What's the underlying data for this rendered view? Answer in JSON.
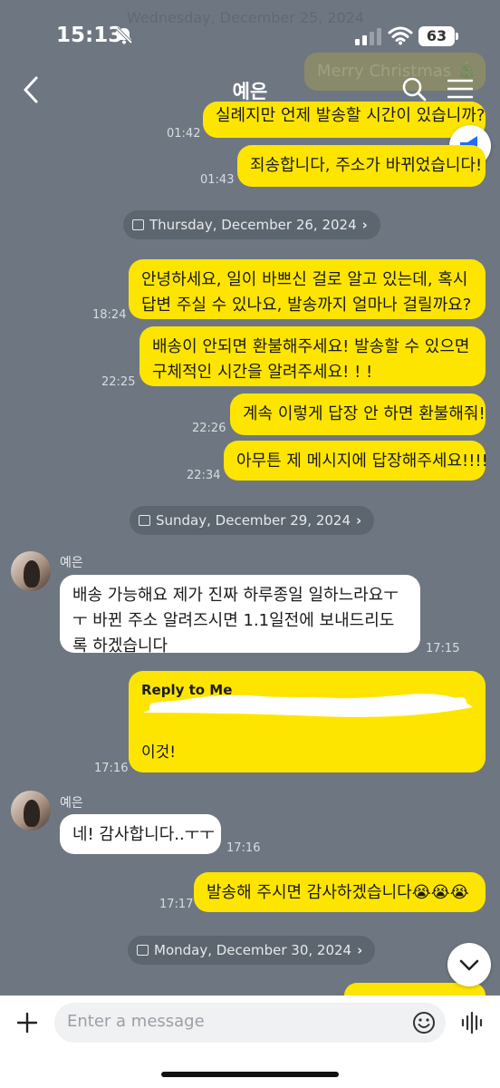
{
  "status_bar": {
    "time": "15:13",
    "battery": "63"
  },
  "ghost": {
    "date": "Wednesday, December 25, 2024",
    "bubble": "Merry Christmas 🎄"
  },
  "header": {
    "title": "예은"
  },
  "messages": {
    "m1": {
      "text": "실례지만 언제 발송할 시간이 있습니까?",
      "time": "01:42"
    },
    "m2": {
      "text": "죄송합니다, 주소가 바뀌었습니다!",
      "time": "01:43"
    },
    "d1": "Thursday, December 26, 2024",
    "m3": {
      "text": "안녕하세요, 일이 바쁘신 걸로 알고 있는데, 혹시 답변 주실 수 있나요, 발송까지 얼마나 걸릴까요?",
      "time": "18:24"
    },
    "m4": {
      "text": "배송이 안되면 환불해주세요! 발송할 수 있으면 구체적인 시간을 알려주세요! ! !",
      "time": "22:25"
    },
    "m5": {
      "text": "계속 이렇게 답장 안 하면 환불해줘!",
      "time": "22:26"
    },
    "m6": {
      "text": "아무튼 제 메시지에 답장해주세요!!!!",
      "time": "22:34"
    },
    "d2": "Sunday, December 29, 2024",
    "sender1": "예은",
    "m7": {
      "text": "배송 가능해요 제가 진짜 하루종일 일하느라요ㅜㅜ 바뀐 주소 알려즈시면 1.1일전에 보내드리도록 하겠습니다",
      "time": "17:15"
    },
    "m8": {
      "reply_label": "Reply to Me",
      "text": "이것!",
      "time": "17:16"
    },
    "sender2": "예은",
    "m9": {
      "text": "네! 감사합니다..ㅜㅜ",
      "time": "17:16"
    },
    "m10": {
      "text": "발송해 주시면 감사하겠습니다😭😭😭",
      "time": "17:17"
    },
    "d3": "Monday, December 30, 2024"
  },
  "input": {
    "placeholder": "Enter a message"
  },
  "colors": {
    "background": "#6e7781",
    "mine": "#fee500",
    "theirs": "#ffffff"
  }
}
